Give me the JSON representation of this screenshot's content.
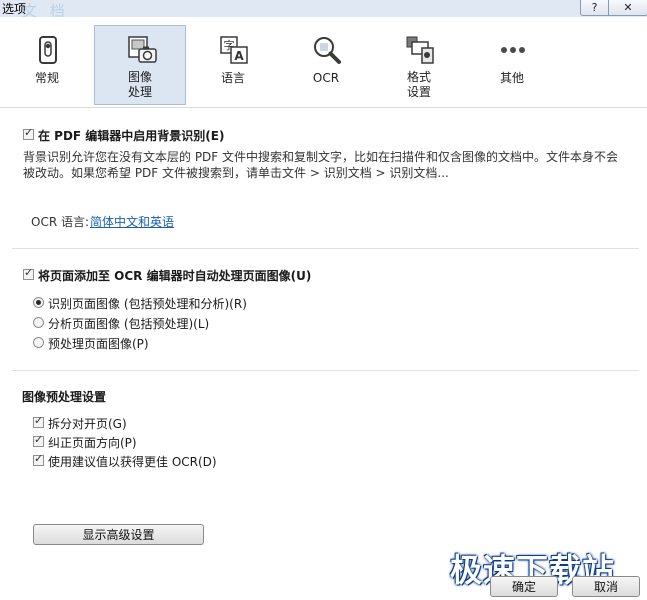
{
  "window": {
    "title": "选项",
    "ghost_title": "文 档",
    "help_label": "?",
    "close_label": "✕"
  },
  "toolbar": {
    "items": [
      {
        "label": "常规",
        "icon": "phone-toggle-icon"
      },
      {
        "label": "图像\n处理",
        "icon": "image-camera-icon",
        "selected": true
      },
      {
        "label": "语言",
        "icon": "language-icon"
      },
      {
        "label": "OCR",
        "icon": "magnifier-icon"
      },
      {
        "label": "格式\n设置",
        "icon": "format-shapes-icon"
      },
      {
        "label": "其他",
        "icon": "more-dots-icon"
      }
    ]
  },
  "section1": {
    "checkbox_label": "在 PDF 编辑器中启用背景识别(E)",
    "desc_line1": "背景识别允许您在没有文本层的 PDF 文件中搜索和复制文字，比如在扫描件和仅含图像的文档中。文件本身不会",
    "desc_line2": "被改动。如果您希望 PDF 文件被搜索到，请单击文件 > 识别文档 > 识别文档...",
    "ocr_lang_label": "OCR  语言:",
    "ocr_lang_value": "简体中文和英语"
  },
  "section2": {
    "checkbox_label": "将页面添加至 OCR 编辑器时自动处理页面图像(U)",
    "options": [
      {
        "label": "识别页面图像 (包括预处理和分析)(R)",
        "selected": true
      },
      {
        "label": "分析页面图像 (包括预处理)(L)",
        "selected": false
      },
      {
        "label": "预处理页面图像(P)",
        "selected": false
      }
    ]
  },
  "section3": {
    "heading": "图像预处理设置",
    "checks": [
      {
        "label": "拆分对开页(G)",
        "checked": true
      },
      {
        "label": "纠正页面方向(P)",
        "checked": true
      },
      {
        "label": "使用建议值以获得更佳 OCR(D)",
        "checked": true
      }
    ],
    "advanced_button": "显示高级设置"
  },
  "footer": {
    "ok_label": "确定",
    "cancel_label": "取消",
    "watermark": "极速下载站"
  },
  "colors": {
    "selected_tab_bg": "#dce6f2",
    "link": "#1a5fb4",
    "watermark_outline": "#0b3d8c"
  }
}
